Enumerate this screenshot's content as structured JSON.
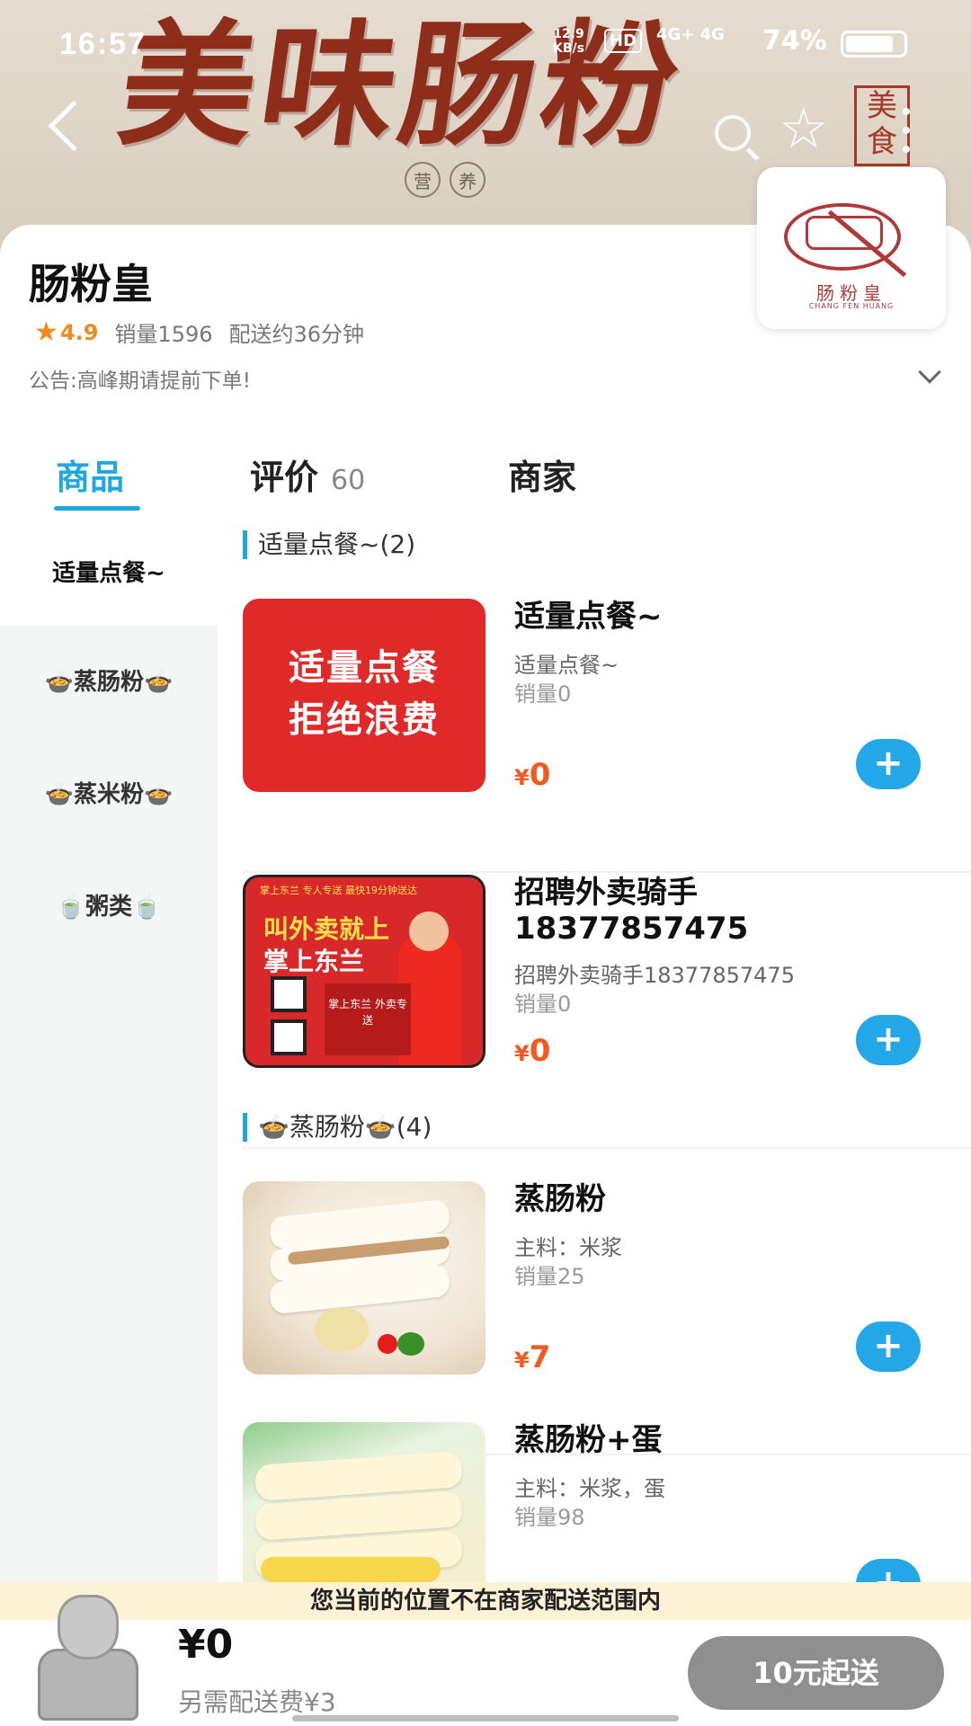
{
  "status_bar": {
    "time": "16:57",
    "net_speed": "12.9",
    "net_unit": "KB/s",
    "hd": "HD",
    "signal": "4G+ 4G",
    "battery": "74%"
  },
  "banner": {
    "title": "美味肠粉",
    "sub_left": "营",
    "sub_right": "养",
    "seal": "美食"
  },
  "shop": {
    "name": "肠粉皇",
    "logo_name": "肠粉皇",
    "logo_en": "CHANG FEN HUANG",
    "rating": "4.9",
    "sales": "销量1596",
    "delivery": "配送约36分钟",
    "notice": "公告:高峰期请提前下单!"
  },
  "tabs": {
    "goods": "商品",
    "reviews": "评价",
    "reviews_count": "60",
    "merchant": "商家"
  },
  "sidebar": {
    "items": [
      {
        "label": "适量点餐~",
        "emoji_left": "",
        "emoji_right": ""
      },
      {
        "label": "蒸肠粉",
        "emoji_left": "🍲",
        "emoji_right": "🍲"
      },
      {
        "label": "蒸米粉",
        "emoji_left": "🍲",
        "emoji_right": "🍲"
      },
      {
        "label": "粥类",
        "emoji_left": "🍵",
        "emoji_right": "🍵"
      }
    ]
  },
  "sections": [
    {
      "title": "适量点餐~(2)"
    },
    {
      "title": "🍲蒸肠粉🍲(4)"
    }
  ],
  "products": [
    {
      "name": "适量点餐~",
      "desc": "适量点餐~",
      "sales": "销量0",
      "currency": "¥",
      "price": "0",
      "thumb_line1": "适量点餐",
      "thumb_line2": "拒绝浪费"
    },
    {
      "name": "招聘外卖骑手18377857475",
      "desc": "招聘外卖骑手18377857475",
      "sales": "销量0",
      "currency": "¥",
      "price": "0",
      "thumb_top": "掌上东兰  专人专送  最快19分钟送达",
      "thumb_line1": "叫外卖就上",
      "thumb_line2": "掌上东兰",
      "thumb_box": "掌上东兰 外卖专送"
    },
    {
      "name": "蒸肠粉",
      "desc": "主料：米浆",
      "sales": "销量25",
      "currency": "¥",
      "price": "7"
    },
    {
      "name": "蒸肠粉+蛋",
      "desc": "主料：米浆，蛋",
      "sales": "销量98",
      "currency": "¥",
      "price": ""
    }
  ],
  "add_label": "+",
  "bottom": {
    "range_notice": "您当前的位置不在商家配送范围内",
    "total": "¥0",
    "fee": "另需配送费¥3",
    "checkout": "10元起送"
  },
  "colors": {
    "accent": "#1da8e0",
    "price": "#f35a1f",
    "rating": "#f28a1e",
    "checkout_disabled": "#8f8f8f"
  }
}
